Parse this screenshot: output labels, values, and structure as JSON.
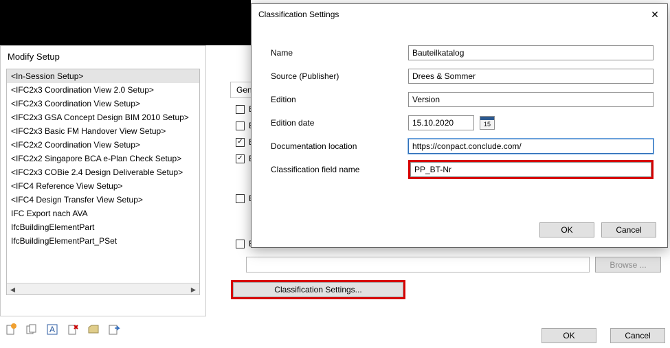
{
  "modify": {
    "title": "Modify Setup",
    "items": [
      "<In-Session Setup>",
      "<IFC2x3 Coordination View 2.0 Setup>",
      "<IFC2x3 Coordination View Setup>",
      "<IFC2x3 GSA Concept Design BIM 2010 Setup>",
      "<IFC2x3 Basic FM Handover View Setup>",
      "<IFC2x2 Coordination View Setup>",
      "<IFC2x2 Singapore BCA e-Plan Check Setup>",
      "<IFC2x3 COBie 2.4 Design Deliverable Setup>",
      "<IFC4 Reference View Setup>",
      "<IFC4 Design Transfer View Setup>",
      "IFC Export nach AVA",
      "IfcBuildingElementPart",
      "IfcBuildingElementPart_PSet"
    ]
  },
  "right": {
    "tab_general": "Genera",
    "check_partials": [
      "Ex",
      "Ex",
      "Ex",
      "Ex",
      "Ex",
      "Ex"
    ],
    "classification_button": "Classification Settings...",
    "browse": "Browse ...",
    "ok": "OK",
    "cancel": "Cancel"
  },
  "dialog": {
    "title": "Classification Settings",
    "labels": {
      "name": "Name",
      "source": "Source (Publisher)",
      "edition": "Edition",
      "edition_date": "Edition date",
      "doc_location": "Documentation location",
      "field_name": "Classification field name"
    },
    "values": {
      "name": "Bauteilkatalog",
      "source": "Drees & Sommer",
      "edition": "Version",
      "edition_date": "15.10.2020",
      "cal_day": "15",
      "doc_location": "https://conpact.conclude.com/",
      "field_name": "PP_BT-Nr"
    },
    "ok": "OK",
    "cancel": "Cancel"
  }
}
